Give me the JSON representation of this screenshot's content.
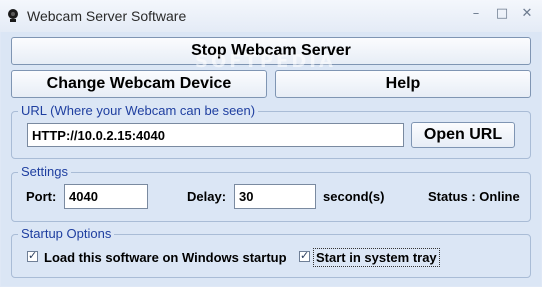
{
  "window": {
    "title": "Webcam Server Software",
    "controls": {
      "minimize": "–",
      "maximize": "□",
      "close": "✕"
    }
  },
  "buttons": {
    "stop_server": "Stop Webcam Server",
    "change_device": "Change Webcam Device",
    "help": "Help",
    "open_url": "Open URL"
  },
  "watermark": "SOFTPEDIA",
  "url_group": {
    "legend": "URL (Where your Webcam can be seen)",
    "value": "HTTP://10.0.2.15:4040"
  },
  "settings": {
    "legend": "Settings",
    "port_label": "Port:",
    "port_value": "4040",
    "delay_label": "Delay:",
    "delay_value": "30",
    "delay_unit": "second(s)",
    "status_text": "Status : Online"
  },
  "startup": {
    "legend": "Startup Options",
    "load_on_startup": {
      "label": "Load this software on Windows startup",
      "checked": true
    },
    "start_in_tray": {
      "label": "Start in system tray",
      "checked": true
    }
  },
  "colors": {
    "background": "#dbe6f5",
    "group_legend": "#1f3fa0",
    "group_border": "#a9bcd6"
  }
}
